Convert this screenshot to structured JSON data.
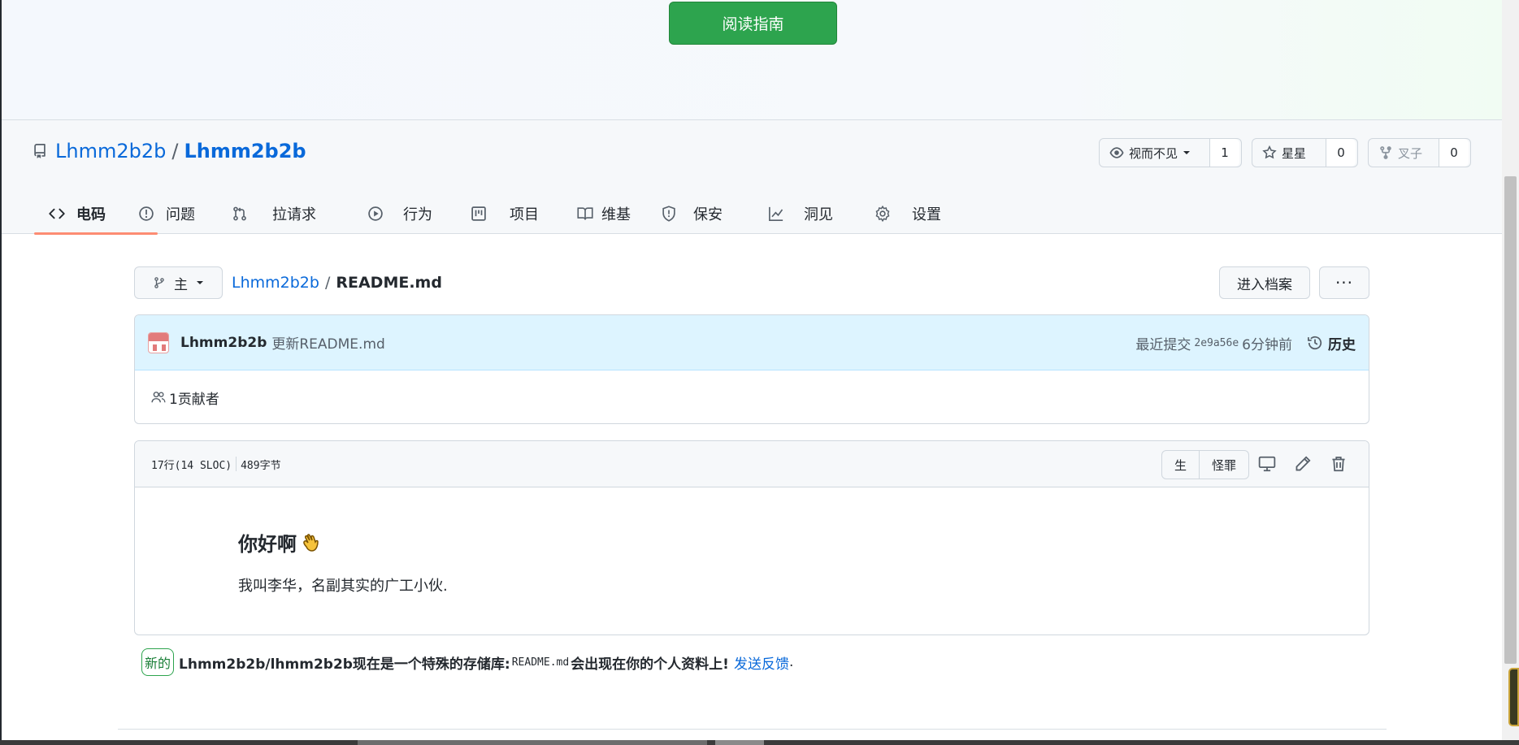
{
  "banner": {
    "guide_button": "阅读指南"
  },
  "repo": {
    "owner": "Lhmm2b2b",
    "separator": "/",
    "name": "Lhmm2b2b",
    "actions": {
      "watch_label": "视而不见",
      "watch_count": "1",
      "star_label": "星星",
      "star_count": "0",
      "fork_label": "叉子",
      "fork_count": "0"
    }
  },
  "tabs": [
    {
      "label": "电码",
      "icon": "code-icon",
      "active": true
    },
    {
      "label": "问题",
      "icon": "issue-icon"
    },
    {
      "label": "拉请求",
      "icon": "pull-request-icon"
    },
    {
      "label": "行为",
      "icon": "play-icon"
    },
    {
      "label": "项目",
      "icon": "project-icon"
    },
    {
      "label": "维基",
      "icon": "book-icon"
    },
    {
      "label": "保安",
      "icon": "shield-icon"
    },
    {
      "label": "洞见",
      "icon": "graph-icon"
    },
    {
      "label": "设置",
      "icon": "gear-icon"
    }
  ],
  "file_nav": {
    "branch": "主",
    "repo_link": "Lhmm2b2b",
    "separator": "/",
    "file_name": "README.md",
    "goto_file": "进入档案",
    "more": "···"
  },
  "commit": {
    "author": "Lhmm2b2b",
    "message": "更新README.md",
    "latest_label": "最近提交",
    "sha": "2e9a56e",
    "time": "6分钟前",
    "history": "历史",
    "contributors": "1贡献者"
  },
  "file": {
    "lines": "17行(14 SLOC)",
    "size": "489字节",
    "raw": "生",
    "blame": "怪罪",
    "readme_heading": "你好啊",
    "readme_text": "我叫李华，名副其实的广工小伙."
  },
  "notice": {
    "badge": "新的",
    "text_prefix": "Lhmm2b2b/lhmm2b2b现在是一个特殊的存储库:",
    "code": "README.md",
    "text_suffix": "会出现在你的个人资料上!",
    "feedback": "发送反馈",
    "feedback_end": "."
  },
  "colors": {
    "primary_button": "#2da44e",
    "link": "#0969da",
    "active_tab_underline": "#fd8c73",
    "commit_header_bg": "#ddf4ff"
  }
}
